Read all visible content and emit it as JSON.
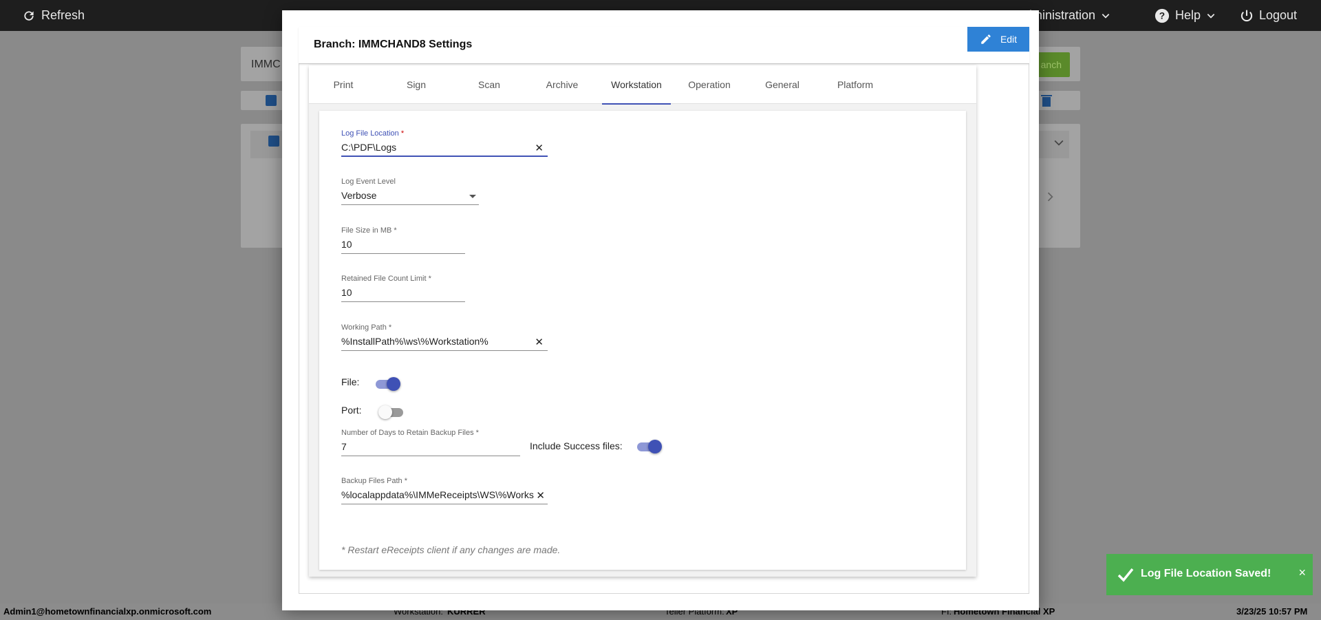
{
  "topbar": {
    "refresh_label": "Refresh",
    "admin_label": "Administration",
    "help_label": "Help",
    "logout_label": "Logout"
  },
  "background": {
    "search_value": "IMMC",
    "branch_button_label": "anch"
  },
  "modal": {
    "title": "Branch: IMMCHAND8 Settings",
    "edit_label": "Edit",
    "tabs": [
      {
        "label": "Print"
      },
      {
        "label": "Sign"
      },
      {
        "label": "Scan"
      },
      {
        "label": "Archive"
      },
      {
        "label": "Workstation"
      },
      {
        "label": "Operation"
      },
      {
        "label": "General"
      },
      {
        "label": "Platform"
      }
    ],
    "active_tab": "Workstation",
    "fields": {
      "log_file_location": {
        "label": "Log File Location",
        "value": "C:\\PDF\\Logs"
      },
      "log_event_level": {
        "label": "Log Event Level",
        "value": "Verbose"
      },
      "file_size": {
        "label": "File Size in MB",
        "value": "10"
      },
      "retained_count": {
        "label": "Retained File Count Limit",
        "value": "10"
      },
      "working_path": {
        "label": "Working Path",
        "value": "%InstallPath%\\ws\\%Workstation%"
      },
      "backup_days": {
        "label": "Number of Days to Retain Backup Files",
        "value": "7"
      },
      "backup_path": {
        "label": "Backup Files Path",
        "value": "%localappdata%\\IMMeReceipts\\WS\\%Works"
      }
    },
    "toggles": {
      "file": {
        "label": "File:",
        "on": true
      },
      "port": {
        "label": "Port:",
        "on": false
      },
      "include_success": {
        "label": "Include Success files:",
        "on": true
      }
    },
    "required_mark": "*",
    "note": "* Restart eReceipts client if any changes are made."
  },
  "toast": {
    "message": "Log File Location Saved!",
    "close": "×"
  },
  "statusbar": {
    "user": "Admin1@hometownfinancialxp.onmicrosoft.com",
    "workstation_label": "Workstation:",
    "workstation": "KURRER",
    "teller_label": "Teller Platform:",
    "teller": "XP",
    "fi_label": "FI:",
    "fi": "Hometown Financial XP",
    "datetime": "3/23/25 10:57 PM"
  },
  "colors": {
    "accent": "#3f51b5",
    "edit_button": "#2f82d6",
    "toast": "#4caf50",
    "topbar": "#1e1e1e"
  }
}
